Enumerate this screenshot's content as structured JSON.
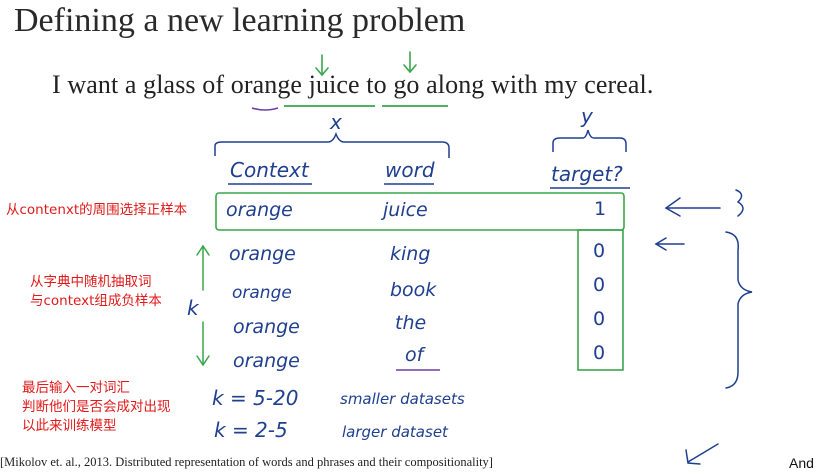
{
  "title": "Defining a new learning problem",
  "sentence": {
    "w1": "I want a glass ",
    "w2": "of",
    "w3": " ",
    "w4": "orange",
    "w5": " ",
    "w6": "juice",
    "w7": " to go along with my cereal."
  },
  "annotations": {
    "x_label": "x",
    "y_label": "y"
  },
  "table": {
    "headers": {
      "context": "Context",
      "word": "word",
      "target": "target?"
    },
    "rows": [
      {
        "context": "orange",
        "word": "juice",
        "target": "1"
      },
      {
        "context": "orange",
        "word": "king",
        "target": "0"
      },
      {
        "context": "orange",
        "word": "book",
        "target": "0"
      },
      {
        "context": "orange",
        "word": "the",
        "target": "0"
      },
      {
        "context": "orange",
        "word": "of",
        "target": "0"
      }
    ],
    "k_label": "k",
    "k_rules": [
      {
        "rule": "k = 5-20",
        "note": "smaller datasets"
      },
      {
        "rule": "k = 2-5",
        "note": "larger dataset"
      }
    ]
  },
  "notes": {
    "positive": "从contenxt的周围选择正样本",
    "negative_line1": "从字典中随机抽取词",
    "negative_line2": "与context组成负样本",
    "train_line1": "最后输入一对词汇",
    "train_line2": "判断他们是否会成对出现",
    "train_line3": "以此来训练模型"
  },
  "footer": {
    "citation": "[Mikolov et. al., 2013. Distributed representation of words and phrases and their compositionality]",
    "and": "And"
  },
  "colors": {
    "ink": "#1f3f8f",
    "green": "#3aa64a",
    "purple": "#6a3fa8",
    "red_note": "#e01a1a"
  }
}
